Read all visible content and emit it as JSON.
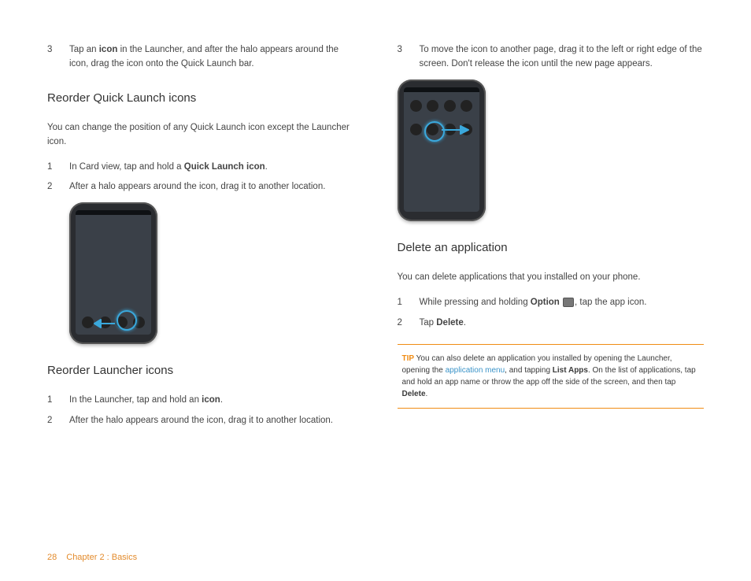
{
  "left": {
    "step3": {
      "num": "3",
      "pre": "Tap an ",
      "b1": "icon",
      "post": " in the Launcher, and after the halo appears around the icon, drag the icon onto the Quick Launch bar."
    },
    "h_reorder_q": "Reorder Quick Launch icons",
    "reorder_q_intro": "You can change the position of any Quick Launch icon except the Launcher icon.",
    "rq1": {
      "num": "1",
      "pre": "In Card view, tap and hold a ",
      "b1": "Quick Launch icon",
      "post": "."
    },
    "rq2": {
      "num": "2",
      "text": "After a halo appears around the icon, drag it to another location."
    },
    "h_reorder_l": "Reorder Launcher icons",
    "rl1": {
      "num": "1",
      "pre": "In the Launcher, tap and hold an ",
      "b1": "icon",
      "post": "."
    },
    "rl2": {
      "num": "2",
      "text": "After the halo appears around the icon, drag it to another location."
    }
  },
  "right": {
    "step3": {
      "num": "3",
      "text": "To move the icon to another page, drag it to the left or right edge of the screen. Don't release the icon until the new page appears."
    },
    "h_delete": "Delete an application",
    "delete_intro": "You can delete applications that you installed on your phone.",
    "d1": {
      "num": "1",
      "pre": "While pressing and holding ",
      "b1": "Option",
      "post": ", tap the app icon."
    },
    "d2": {
      "num": "2",
      "pre": "Tap ",
      "b1": "Delete",
      "post": "."
    },
    "tip": {
      "label": "TIP",
      "t1": " You can also delete an application you installed by opening the Launcher, opening the ",
      "link": "application menu",
      "t2": ", and tapping ",
      "b2": "List Apps",
      "t3": ". On the list of applications, tap and hold an app name or throw the app off the side of the screen, and then tap ",
      "b3": "Delete",
      "t4": "."
    }
  },
  "footer": {
    "page": "28",
    "chapter": "Chapter 2 : Basics"
  }
}
